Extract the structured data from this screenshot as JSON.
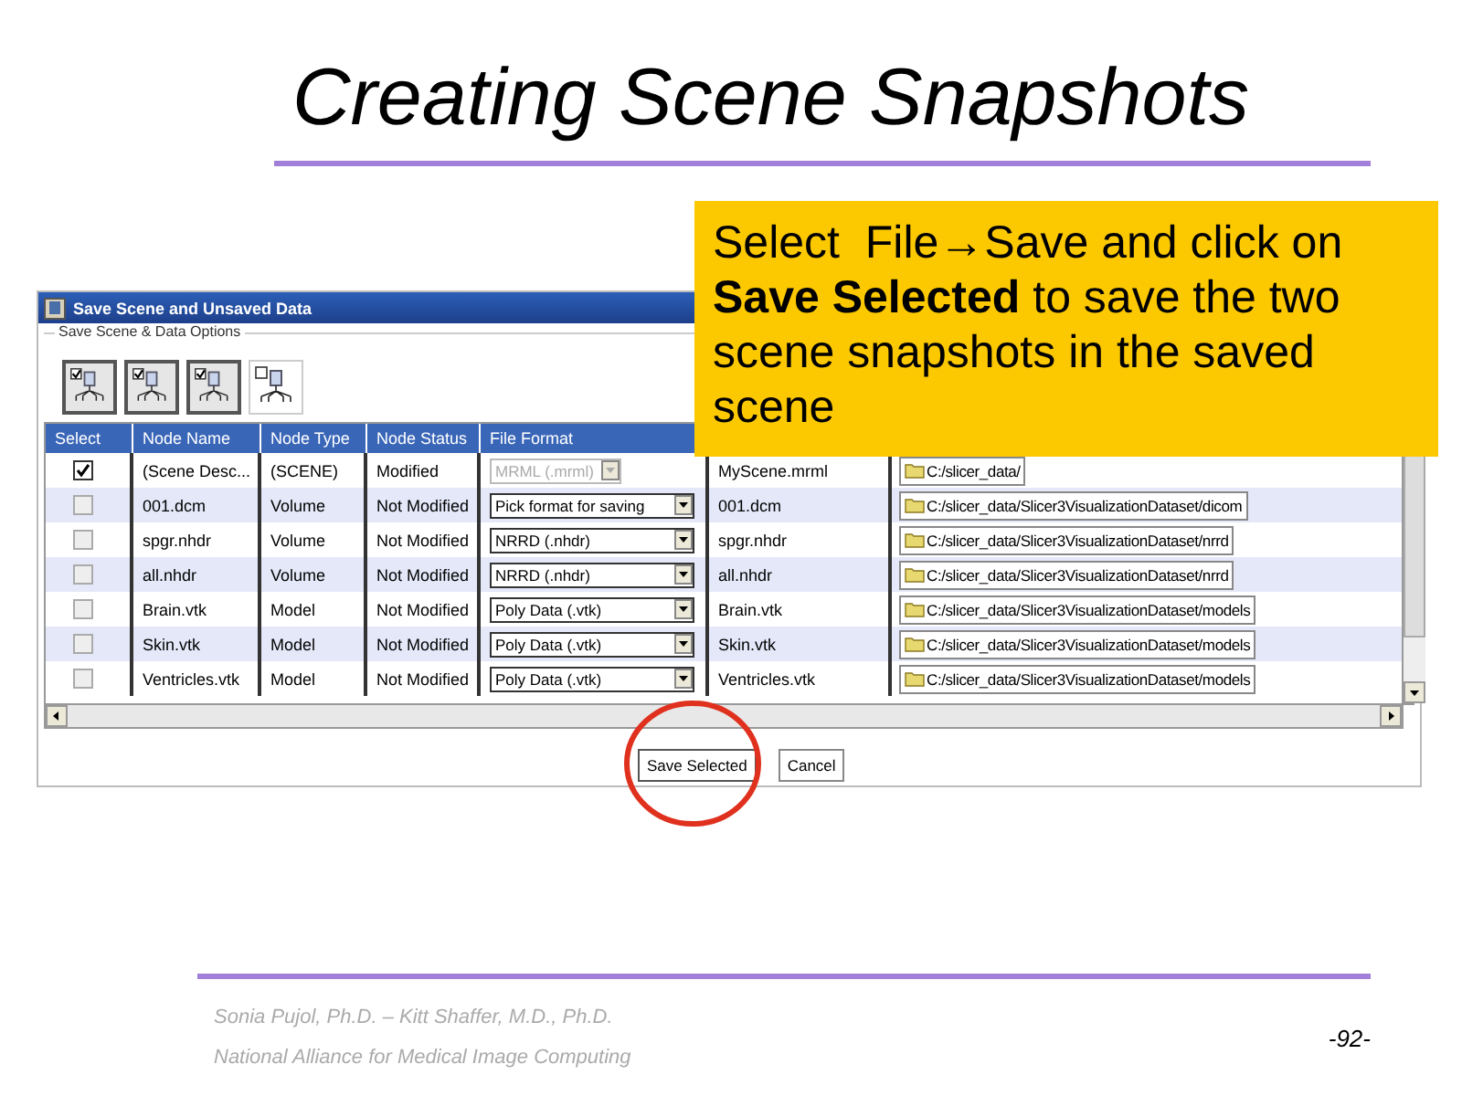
{
  "slide": {
    "title": "Creating Scene Snapshots"
  },
  "callout": {
    "text": "Select  File→Save and click on **Save Selected** to save the two scene snapshots in the saved scene"
  },
  "dialog": {
    "title": "Save Scene and Unsaved Data",
    "group_label": "Save Scene & Data Options",
    "toolbar": [
      {
        "checked": true
      },
      {
        "checked": true
      },
      {
        "checked": true
      },
      {
        "checked": false
      }
    ],
    "columns": [
      "Select",
      "Node Name",
      "Node Type",
      "Node Status",
      "File Format"
    ],
    "rows": [
      {
        "checked": true,
        "name": "(Scene Desc...",
        "type": "(SCENE)",
        "status": "Modified",
        "format": "MRML (.mrml)",
        "format_disabled": true,
        "file": "MyScene.mrml",
        "directory": "C:/slicer_data/"
      },
      {
        "checked": false,
        "name": "001.dcm",
        "type": "Volume",
        "status": "Not Modified",
        "format": "Pick format for saving",
        "format_disabled": false,
        "file": "001.dcm",
        "directory": "C:/slicer_data/Slicer3VisualizationDataset/dicom"
      },
      {
        "checked": false,
        "name": "spgr.nhdr",
        "type": "Volume",
        "status": "Not Modified",
        "format": "NRRD (.nhdr)",
        "format_disabled": false,
        "file": "spgr.nhdr",
        "directory": "C:/slicer_data/Slicer3VisualizationDataset/nrrd"
      },
      {
        "checked": false,
        "name": "all.nhdr",
        "type": "Volume",
        "status": "Not Modified",
        "format": "NRRD (.nhdr)",
        "format_disabled": false,
        "file": "all.nhdr",
        "directory": "C:/slicer_data/Slicer3VisualizationDataset/nrrd"
      },
      {
        "checked": false,
        "name": "Brain.vtk",
        "type": "Model",
        "status": "Not Modified",
        "format": "Poly Data (.vtk)",
        "format_disabled": false,
        "file": "Brain.vtk",
        "directory": "C:/slicer_data/Slicer3VisualizationDataset/models"
      },
      {
        "checked": false,
        "name": "Skin.vtk",
        "type": "Model",
        "status": "Not Modified",
        "format": "Poly Data (.vtk)",
        "format_disabled": false,
        "file": "Skin.vtk",
        "directory": "C:/slicer_data/Slicer3VisualizationDataset/models"
      },
      {
        "checked": false,
        "name": "Ventricles.vtk",
        "type": "Model",
        "status": "Not Modified",
        "format": "Poly Data (.vtk)",
        "format_disabled": false,
        "file": "Ventricles.vtk",
        "directory": "C:/slicer_data/Slicer3VisualizationDataset/models"
      }
    ],
    "buttons": [
      {
        "label": "Save Selected",
        "highlighted": true
      },
      {
        "label": "Cancel",
        "highlighted": false
      }
    ]
  },
  "footer": {
    "authors": "Sonia Pujol, Ph.D. – Kitt Shaffer, M.D., Ph.D.",
    "organization": "National Alliance for Medical Image Computing",
    "page": "-92-"
  }
}
